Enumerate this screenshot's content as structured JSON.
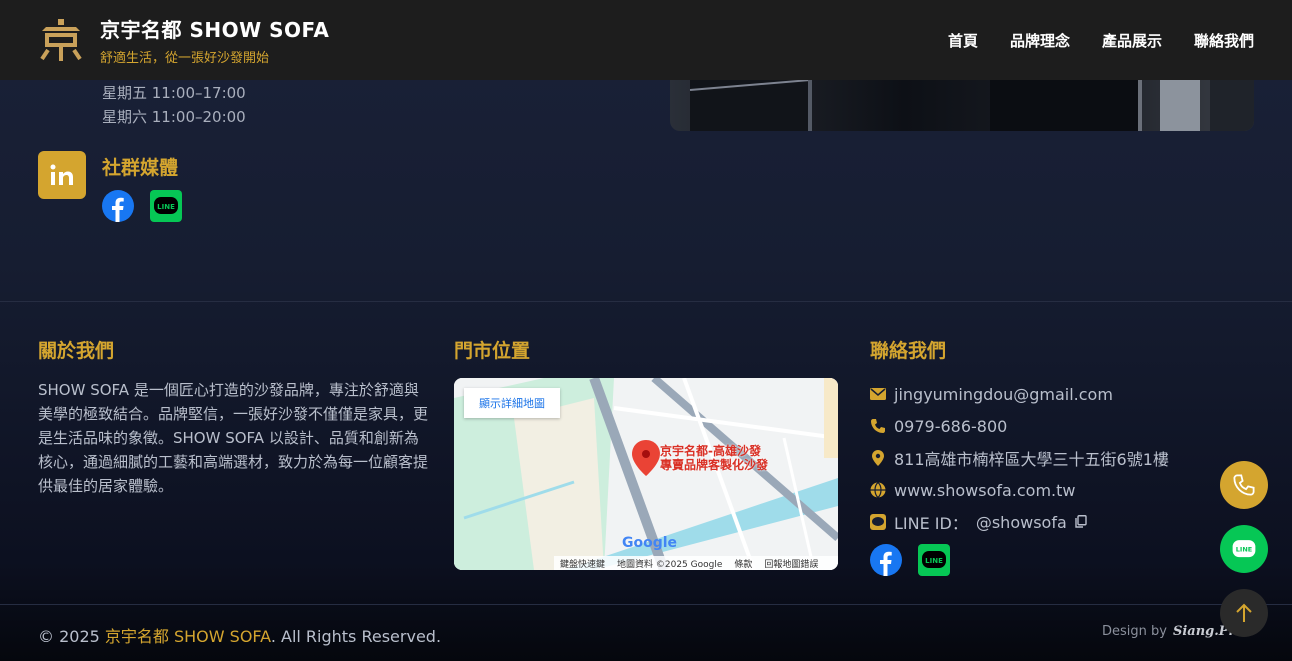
{
  "header": {
    "title": "京宇名都 SHOW SOFA",
    "tagline": "舒適生活，從一張好沙發開始",
    "nav": [
      "首頁",
      "品牌理念",
      "產品展示",
      "聯絡我們"
    ]
  },
  "hours": {
    "fri": "星期五 11:00–17:00",
    "sat": "星期六 11:00–20:00"
  },
  "social": {
    "title": "社群媒體"
  },
  "about": {
    "title": "關於我們",
    "text": "SHOW SOFA 是一個匠心打造的沙發品牌，專注於舒適與美學的極致結合。品牌堅信，一張好沙發不僅僅是家具，更是生活品味的象徵。SHOW SOFA 以設計、品質和創新為核心，通過細膩的工藝和高端選材，致力於為每一位顧客提供最佳的居家體驗。"
  },
  "store": {
    "title": "門市位置",
    "map_link": "顯示詳細地圖",
    "pin_label_1": "京宇名都-高雄沙發",
    "pin_label_2": "專賣品牌客製化沙發",
    "footer": [
      "鍵盤快速鍵",
      "地圖資料 ©2025 Google",
      "條款",
      "回報地圖錯誤"
    ],
    "google": "Google"
  },
  "contact": {
    "title": "聯絡我們",
    "email": "jingyumingdou@gmail.com",
    "phone": "0979-686-800",
    "address": "811高雄市楠梓區大學三十五街6號1樓",
    "website": "www.showsofa.com.tw",
    "line_label": "LINE ID：",
    "line_id": "@showsofa"
  },
  "footer": {
    "copy_prefix": "© 2025 ",
    "copy_brand": "京宇名都 SHOW SOFA",
    "copy_suffix": ". All Rights Reserved.",
    "design_label": "Design by",
    "design_sig": "Siang.Pro"
  },
  "colors": {
    "gold": "#d4a52f",
    "line_green": "#06c755",
    "facebook_blue": "#1877f2"
  }
}
